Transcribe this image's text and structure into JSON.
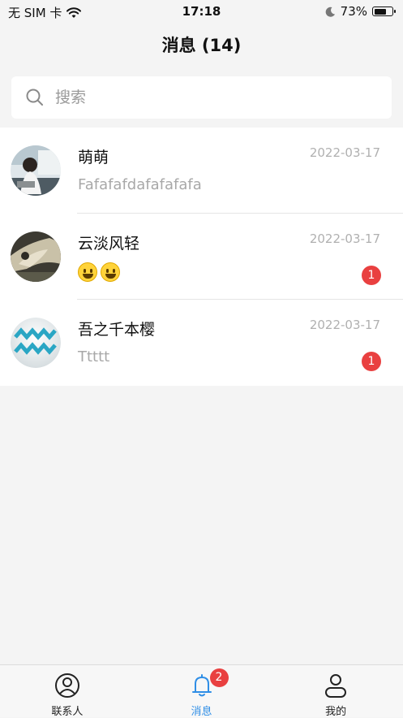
{
  "status_bar": {
    "carrier": "无 SIM 卡",
    "time": "17:18",
    "battery": "73%",
    "battery_level": 0.73
  },
  "header": {
    "title": "消息 (14)"
  },
  "search": {
    "placeholder": "搜索"
  },
  "conversations": [
    {
      "name": "萌萌",
      "date": "2022-03-17",
      "preview": "Fafafafdafafafafa",
      "unread": ""
    },
    {
      "name": "云淡风轻",
      "date": "2022-03-17",
      "preview": "",
      "emojis": [
        "grinning-face",
        "grinning-face"
      ],
      "unread": "1"
    },
    {
      "name": "吾之千本樱",
      "date": "2022-03-17",
      "preview": "Ttttt",
      "unread": "1"
    }
  ],
  "tabbar": {
    "tabs": [
      {
        "label": "联系人",
        "icon": "contacts-icon",
        "active": false,
        "badge": ""
      },
      {
        "label": "消息",
        "icon": "bell-icon",
        "active": true,
        "badge": "2"
      },
      {
        "label": "我的",
        "icon": "person-icon",
        "active": false,
        "badge": ""
      }
    ]
  },
  "colors": {
    "accent": "#2f8ee6",
    "badge": "#e94040",
    "background": "#f4f4f4"
  }
}
